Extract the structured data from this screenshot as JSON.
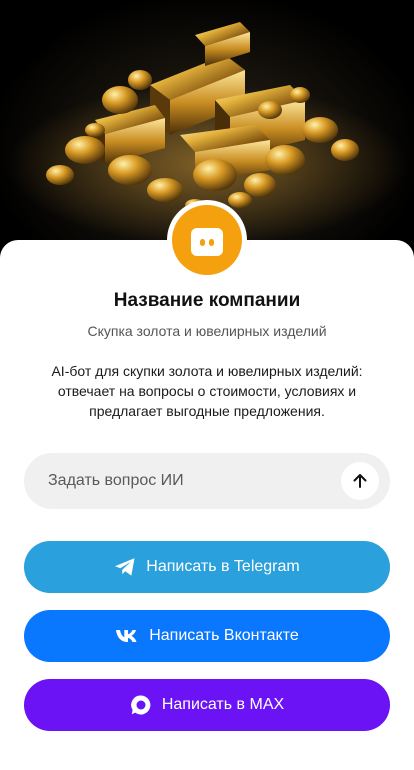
{
  "hero": {
    "image": "gold-bars-and-nuggets"
  },
  "company": {
    "name": "Название компании",
    "subtitle": "Скупка золота и ювелирных изделий",
    "description": "AI-бот для скупки золота и ювелирных изделий: отвечает на вопросы о стоимости, условиях и предлагает выгодные предложения.",
    "avatar_icon": "chat-bot-icon",
    "avatar_color": "#f5a00f"
  },
  "ask": {
    "placeholder": "Задать вопрос ИИ",
    "send_icon": "arrow-up-icon"
  },
  "actions": {
    "telegram": {
      "label": "Написать в Telegram",
      "icon": "telegram-icon",
      "color": "#2aa0dc"
    },
    "vk": {
      "label": "Написать Вконтакте",
      "icon": "vk-icon",
      "color": "#0a77ff"
    },
    "max": {
      "label": "Написать в MAX",
      "icon": "max-icon",
      "color": "#6b13f5"
    }
  }
}
